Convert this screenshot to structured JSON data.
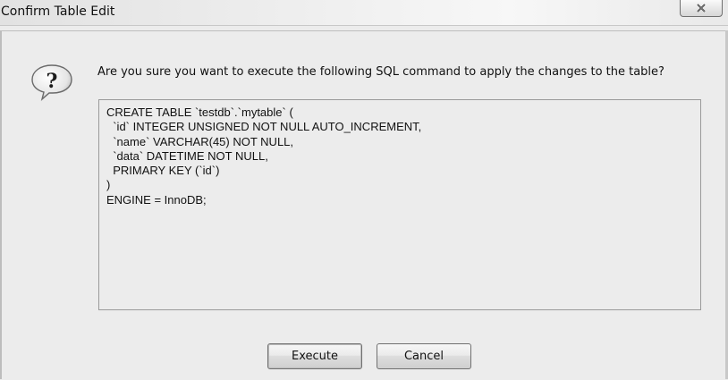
{
  "window": {
    "title": "Confirm Table Edit",
    "close_icon": "close-icon"
  },
  "dialog": {
    "icon": "question-icon",
    "icon_glyph": "?",
    "prompt": "Are you sure you want to execute the following SQL command to apply the changes to the table?",
    "sql": "CREATE TABLE `testdb`.`mytable` (\n  `id` INTEGER UNSIGNED NOT NULL AUTO_INCREMENT,\n  `name` VARCHAR(45) NOT NULL,\n  `data` DATETIME NOT NULL,\n  PRIMARY KEY (`id`)\n)\nENGINE = InnoDB;"
  },
  "buttons": {
    "execute_label": "Execute",
    "cancel_label": "Cancel"
  }
}
